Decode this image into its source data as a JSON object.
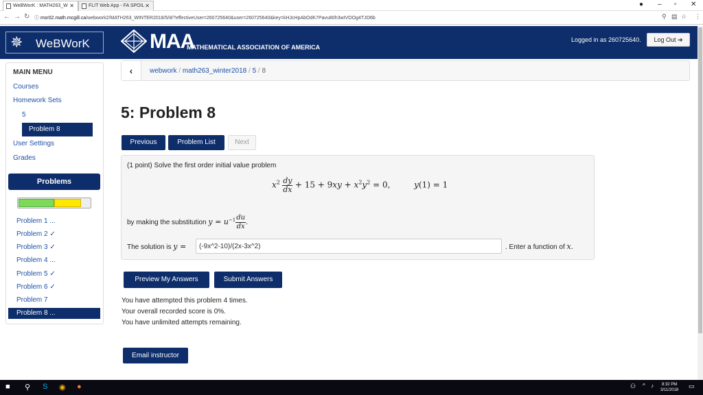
{
  "browser": {
    "tabs": [
      {
        "label": "WeBWorK : MATH263_W"
      },
      {
        "label": "FLIT Web App - FA SPOIL"
      }
    ],
    "url_host": "msr02.math.mcgill.ca",
    "url_path": "/webwork2/MATH263_WINTER2018/5/8/?effectiveUser=260725640&user=260725640&key=kHJcHpAbOdK7Pavu80h3wIVOOg4TJO6b"
  },
  "navbar": {
    "brand": "WeBWorK",
    "maa_logo_text": "MAA",
    "maa_subtitle": "MATHEMATICAL ASSOCIATION OF AMERICA",
    "logged_in_text": "Logged in as 260725640.",
    "logout_label": "Log Out"
  },
  "sidebar": {
    "menu_title": "MAIN MENU",
    "courses": "Courses",
    "homework_sets": "Homework Sets",
    "set_number": "5",
    "active_problem": "Problem 8",
    "user_settings": "User Settings",
    "grades": "Grades",
    "problems_button": "Problems",
    "progress": [
      {
        "fraction": 0.5,
        "color": "#7ed957"
      },
      {
        "fraction": 0.375,
        "color": "#ffe800"
      }
    ],
    "problem_list": [
      "Problem 1 ...",
      "Problem 2 ✓",
      "Problem 3 ✓",
      "Problem 4 ...",
      "Problem 5 ✓",
      "Problem 6 ✓",
      "Problem 7",
      "Problem 8 ..."
    ]
  },
  "breadcrumb": {
    "root": "webwork",
    "course": "math263_winter2018",
    "set": "5",
    "problem": "8"
  },
  "page_title": "5: Problem 8",
  "nav_buttons": {
    "previous": "Previous",
    "problem_list": "Problem List",
    "next": "Next"
  },
  "problem": {
    "intro": "(1 point) Solve the first order initial value problem",
    "by_substitution": "by making the substitution",
    "solution_label": "The solution is",
    "answer_value": "(-9x^2-10)/(2x-3x^2)",
    "enter_function": ". Enter a function of"
  },
  "actions": {
    "preview": "Preview My Answers",
    "submit": "Submit Answers",
    "email": "Email instructor"
  },
  "status": {
    "attempts": "You have attempted this problem 4 times.",
    "score": "Your overall recorded score is 0%.",
    "remaining": "You have unlimited attempts remaining."
  },
  "taskbar": {
    "time": "8:32 PM",
    "date": "3/11/2018"
  },
  "colors": {
    "navbar": "#0d2d6b",
    "link": "#1d4fa5"
  }
}
